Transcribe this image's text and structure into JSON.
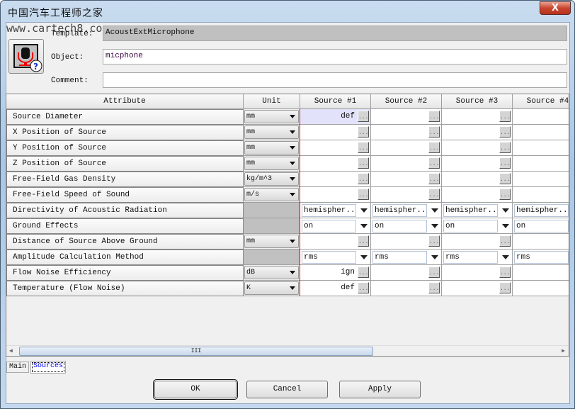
{
  "window": {
    "watermark_title": "中国汽车工程师之家",
    "watermark_url": "www.cartech8.com",
    "close_label": "X"
  },
  "form": {
    "template_label": "Template:",
    "template_value": "AcoustExtMicrophone",
    "object_label": "Object:",
    "object_value": "micphone",
    "comment_label": "Comment:",
    "comment_value": ""
  },
  "grid": {
    "headers": [
      "Attribute",
      "Unit",
      "Source #1",
      "Source #2",
      "Source #3",
      "Source #4"
    ],
    "rows": [
      {
        "attribute": "Source Diameter",
        "unit": "mm",
        "kind": "button",
        "values": [
          "def",
          "",
          "",
          ""
        ]
      },
      {
        "attribute": "X Position of Source",
        "unit": "mm",
        "kind": "button",
        "values": [
          "",
          "",
          "",
          ""
        ]
      },
      {
        "attribute": "Y Position of Source",
        "unit": "mm",
        "kind": "button",
        "values": [
          "",
          "",
          "",
          ""
        ]
      },
      {
        "attribute": "Z Position of Source",
        "unit": "mm",
        "kind": "button",
        "values": [
          "",
          "",
          "",
          ""
        ]
      },
      {
        "attribute": "Free-Field Gas Density",
        "unit": "kg/m^3",
        "kind": "button",
        "values": [
          "",
          "",
          "",
          ""
        ]
      },
      {
        "attribute": "Free-Field Speed of Sound",
        "unit": "m/s",
        "kind": "button",
        "values": [
          "",
          "",
          "",
          ""
        ]
      },
      {
        "attribute": "Directivity of Acoustic Radiation",
        "unit": null,
        "kind": "select",
        "values": [
          "hemispher...",
          "hemispher...",
          "hemispher...",
          "hemispher..."
        ]
      },
      {
        "attribute": "Ground Effects",
        "unit": null,
        "kind": "select",
        "values": [
          "on",
          "on",
          "on",
          "on"
        ]
      },
      {
        "attribute": "Distance of Source Above Ground",
        "unit": "mm",
        "kind": "button",
        "values": [
          "",
          "",
          "",
          ""
        ]
      },
      {
        "attribute": "Amplitude Calculation Method",
        "unit": null,
        "kind": "select",
        "values": [
          "rms",
          "rms",
          "rms",
          "rms"
        ]
      },
      {
        "attribute": "Flow Noise Efficiency",
        "unit": "dB",
        "kind": "button",
        "values": [
          "ign",
          "",
          "",
          ""
        ]
      },
      {
        "attribute": "Temperature (Flow Noise)",
        "unit": "K",
        "kind": "button",
        "values": [
          "def",
          "",
          "",
          ""
        ]
      }
    ],
    "button_glyph": "...",
    "scroll_grip": "III"
  },
  "tabs": [
    {
      "label": "Main",
      "active": false
    },
    {
      "label": "Sources",
      "active": true
    }
  ],
  "buttons": {
    "ok": "OK",
    "cancel": "Cancel",
    "apply": "Apply"
  },
  "colors": {
    "selected_cell": "#e2e2fb",
    "active_tab_text": "#0000ff",
    "readonly_field": "#c0c0c0"
  }
}
